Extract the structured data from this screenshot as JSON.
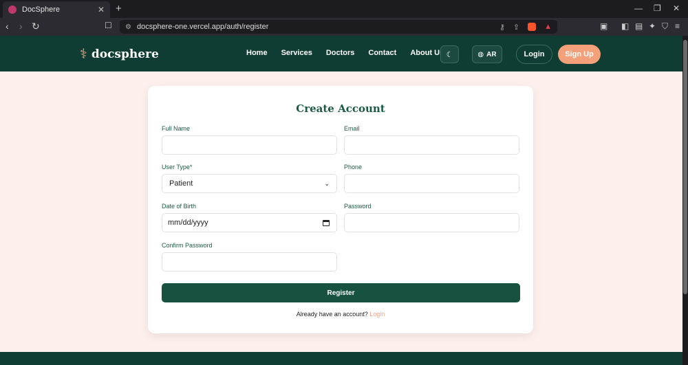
{
  "browser": {
    "tab_title": "DocSphere",
    "tab_close": "✕",
    "new_tab": "+",
    "url": "docsphere-one.vercel.app/auth/register"
  },
  "header": {
    "brand": "docsphere",
    "nav": [
      "Home",
      "Services",
      "Doctors",
      "Contact",
      "About Us"
    ],
    "lang_label": "AR",
    "login_label": "Login",
    "signup_label": "Sign Up"
  },
  "form": {
    "title": "Create Account",
    "full_name_label": "Full Name",
    "email_label": "Email",
    "user_type_label": "User Type*",
    "user_type_value": "Patient",
    "phone_label": "Phone",
    "dob_label": "Date of Birth",
    "dob_placeholder": "mm/dd/yyyy",
    "password_label": "Password",
    "confirm_password_label": "Confirm Password",
    "register_label": "Register",
    "have_account_text": "Already have an account?",
    "login_link": "Login"
  },
  "colors": {
    "brand_dark": "#0f3d33",
    "accent": "#f3a07b",
    "page_bg": "#fdf0ec",
    "button_green": "#16523f"
  }
}
